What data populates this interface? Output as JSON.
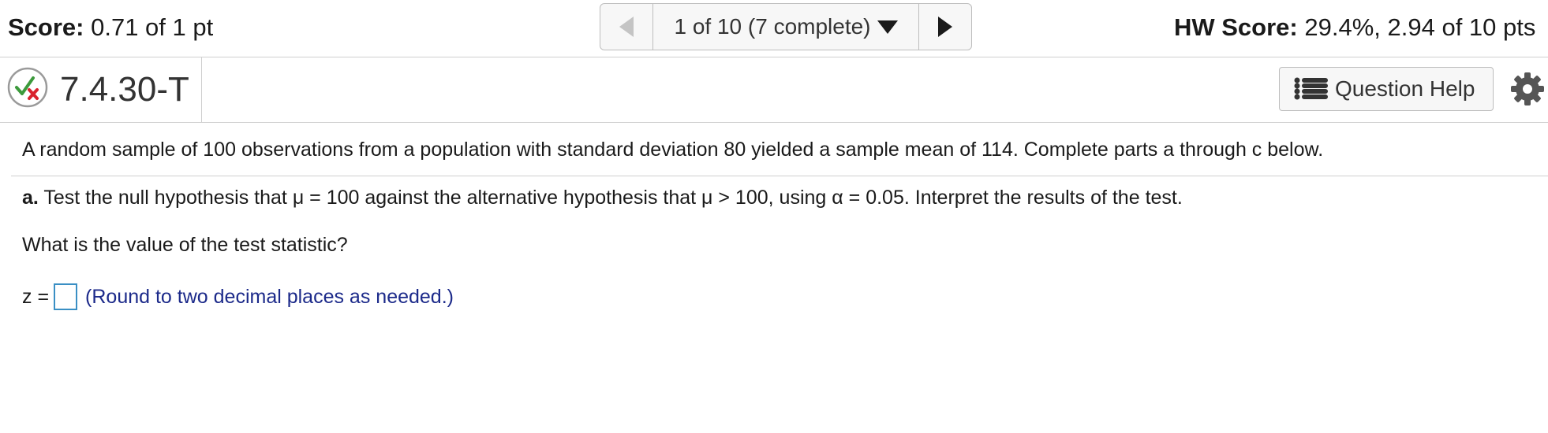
{
  "topbar": {
    "score_label": "Score:",
    "score_value": "0.71 of 1 pt",
    "pager_status": "1 of 10 (7 complete)",
    "hw_score_label": "HW Score:",
    "hw_score_value": "29.4%, 2.94 of 10 pts"
  },
  "question": {
    "id": "7.4.30-T",
    "status_icon": "partial-correct-icon",
    "help_label": "Question Help",
    "help_icon": "list-icon",
    "settings_icon": "gear-icon"
  },
  "body": {
    "intro": "A random sample of 100 observations from a population with standard deviation 80 yielded a sample mean of 114. Complete parts a through c below.",
    "part_a_label": "a.",
    "part_a_text": "Test the null hypothesis that μ = 100 against the alternative hypothesis that μ > 100, using α = 0.05. Interpret the results of the test.",
    "prompt": "What is the value of the test statistic?",
    "answer_label": "z =",
    "answer_value": "",
    "hint": "(Round to two decimal places as needed.)"
  },
  "colors": {
    "hint_text": "#1c2a8a",
    "input_border": "#3a8fc4",
    "check_green": "#3c9a3c",
    "cross_red": "#d9232e"
  }
}
